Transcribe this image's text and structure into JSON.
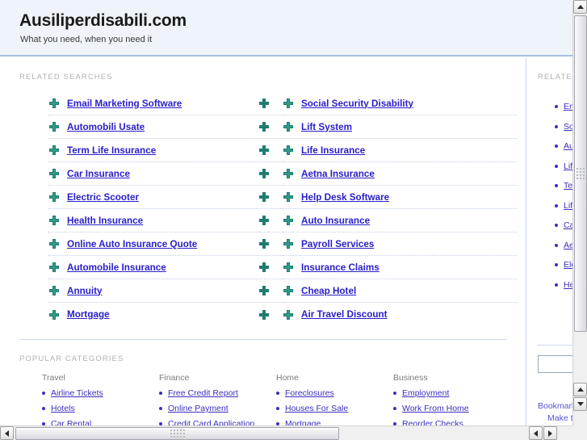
{
  "header": {
    "title": "Ausiliperdisabili.com",
    "tagline": "What you need, when you need it"
  },
  "sections": {
    "related_searches_label": "RELATED SEARCHES",
    "popular_categories_label": "POPULAR CATEGORIES",
    "sidebar_related_label": "RELATED"
  },
  "related_searches": {
    "left_column": [
      "Email Marketing Software",
      "Automobili Usate",
      "Term Life Insurance",
      "Car Insurance",
      "Electric Scooter",
      "Health Insurance",
      "Online Auto Insurance Quote",
      "Automobile Insurance",
      "Annuity",
      "Mortgage"
    ],
    "right_column": [
      "Social Security Disability",
      "Lift System",
      "Life Insurance",
      "Aetna Insurance",
      "Help Desk Software",
      "Auto Insurance",
      "Payroll Services",
      "Insurance Claims",
      "Cheap Hotel",
      "Air Travel Discount"
    ]
  },
  "popular_categories": [
    {
      "title": "Travel",
      "items": [
        "Airline Tickets",
        "Hotels",
        "Car Rental"
      ]
    },
    {
      "title": "Finance",
      "items": [
        "Free Credit Report",
        "Online Payment",
        "Credit Card Application"
      ]
    },
    {
      "title": "Home",
      "items": [
        "Foreclosures",
        "Houses For Sale",
        "Mortgage"
      ]
    },
    {
      "title": "Business",
      "items": [
        "Employment",
        "Work From Home",
        "Reorder Checks"
      ]
    }
  ],
  "sidebar": {
    "items": [
      "Email Marketing Software",
      "Social Security Disability",
      "Automobili Usate",
      "Lift System",
      "Term Life Insurance",
      "Life Insurance",
      "Car Insurance",
      "Aetna Insurance",
      "Electric Scooter",
      "Health Insurance"
    ],
    "search_value": "",
    "search_placeholder": "",
    "footer_links": [
      "Bookmark",
      "Make this"
    ]
  },
  "colors": {
    "header_bg": "#eef4f9",
    "header_border": "#a8bede",
    "link": "#2a20c8",
    "category_link": "#3b2fbf",
    "bullet": "#1f7d6e",
    "label": "#b0b0b0"
  },
  "icons": {
    "bullet": "plus-arrow-icon",
    "scroll_up": "triangle-up-icon",
    "scroll_down": "triangle-down-icon",
    "scroll_left": "triangle-left-icon",
    "scroll_right": "triangle-right-icon"
  }
}
